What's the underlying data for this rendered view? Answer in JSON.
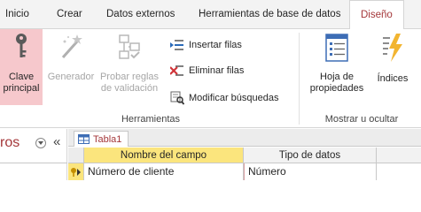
{
  "tabs": [
    {
      "label": "Inicio"
    },
    {
      "label": "Crear"
    },
    {
      "label": "Datos externos"
    },
    {
      "label": "Herramientas de base de datos"
    },
    {
      "label": "Diseño"
    }
  ],
  "ribbon": {
    "primary_key": {
      "line1": "Clave",
      "line2": "principal"
    },
    "generator": {
      "label": "Generador"
    },
    "test_rules": {
      "line1": "Probar reglas",
      "line2": "de validación"
    },
    "insert_rows": "Insertar filas",
    "delete_rows": "Eliminar filas",
    "modify_lookups": "Modificar búsquedas",
    "property_sheet": {
      "line1": "Hoja de",
      "line2": "propiedades"
    },
    "indexes": {
      "label": "Índices"
    },
    "group_tools": "Herramientas",
    "group_show_hide": "Mostrar u ocultar"
  },
  "nav_pane": {
    "title_fragment": "ros",
    "chevrons": "«"
  },
  "document_tab": {
    "label": "Tabla1"
  },
  "grid": {
    "headers": [
      "Nombre del campo",
      "Tipo de datos"
    ],
    "rows": [
      {
        "field": "Número de cliente",
        "type": "Número"
      }
    ]
  },
  "colors": {
    "accent": "#a4373a",
    "highlight": "#f6c8cc",
    "header_yellow": "#fbe57d"
  }
}
